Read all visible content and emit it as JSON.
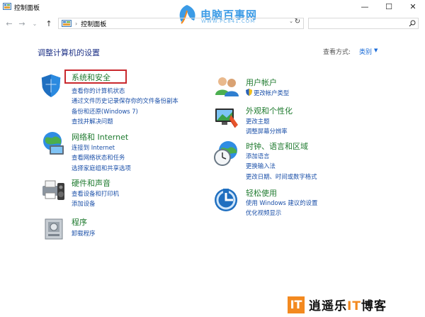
{
  "window": {
    "title": "控制面板",
    "min_label": "—",
    "max_label": "☐",
    "close_label": "✕"
  },
  "watermark": {
    "brand": "电脑百事网",
    "url": "WWW.PC841.COM"
  },
  "address": {
    "separator": "›",
    "path": "控制面板",
    "search_placeholder": ""
  },
  "main": {
    "heading": "调整计算机的设置",
    "view_by_label": "查看方式:",
    "view_by_value": "类别"
  },
  "categories": [
    {
      "title": "系统和安全",
      "links": [
        "查看你的计算机状态",
        "通过文件历史记录保存你的文件备份副本",
        "备份和还原(Windows 7)",
        "查找并解决问题"
      ]
    },
    {
      "title": "网络和 Internet",
      "links": [
        "连接到 Internet",
        "查看网络状态和任务",
        "选择家庭组和共享选项"
      ]
    },
    {
      "title": "硬件和声音",
      "links": [
        "查看设备和打印机",
        "添加设备"
      ]
    },
    {
      "title": "程序",
      "links": [
        "卸载程序"
      ]
    },
    {
      "title": "用户帐户",
      "links": [
        "更改帐户类型"
      ]
    },
    {
      "title": "外观和个性化",
      "links": [
        "更改主题",
        "调整屏幕分辨率"
      ]
    },
    {
      "title": "时钟、语言和区域",
      "links": [
        "添加语言",
        "更换输入法",
        "更改日期、时间或数字格式"
      ]
    },
    {
      "title": "轻松使用",
      "links": [
        "使用 Windows 建议的设置",
        "优化视频显示"
      ]
    }
  ],
  "footer_mark": {
    "logo": "IT",
    "text_a": "逍遥乐",
    "text_b": "IT",
    "text_c": "博客"
  },
  "colors": {
    "category_title": "#1e7a2e",
    "link": "#1a4fa8",
    "heading": "#1e3287",
    "highlight": "#c9282d"
  }
}
